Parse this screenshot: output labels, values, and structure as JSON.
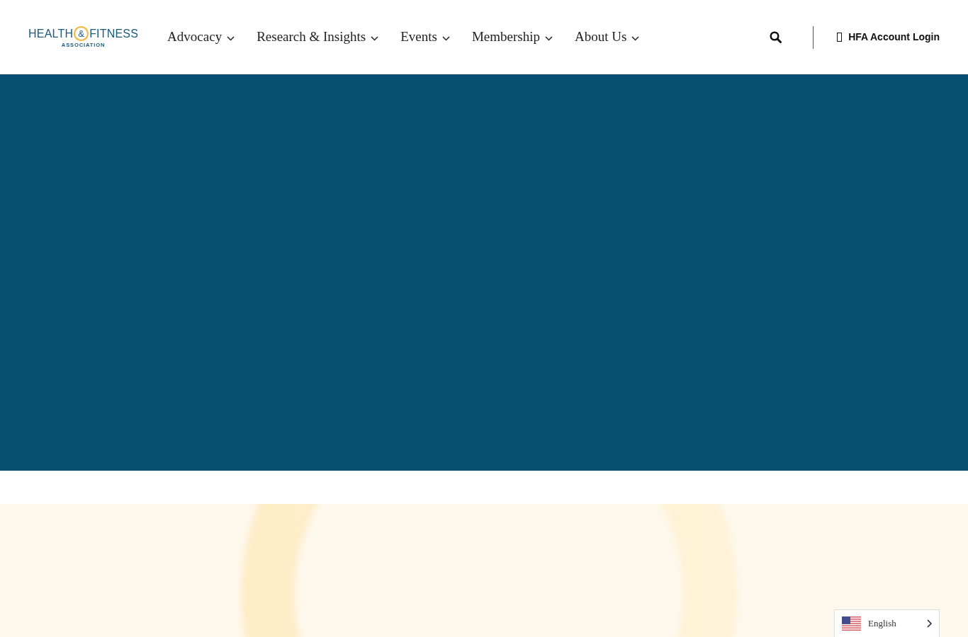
{
  "header": {
    "logo": {
      "word_1": "HEALTH",
      "ampersand": "&",
      "word_2": "FITNESS",
      "subtitle": "ASSOCIATION"
    },
    "nav": [
      {
        "label": "Advocacy"
      },
      {
        "label": "Research & Insights"
      },
      {
        "label": "Events"
      },
      {
        "label": "Membership"
      },
      {
        "label": "About Us"
      }
    ],
    "account_login": {
      "label": "HFA Account Login"
    }
  },
  "language_selector": {
    "label": "English"
  }
}
